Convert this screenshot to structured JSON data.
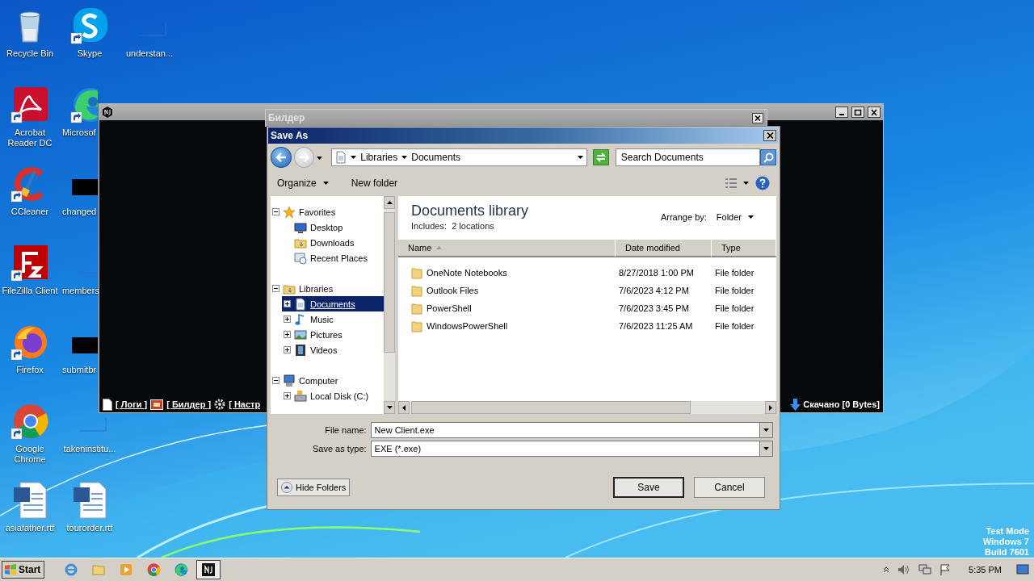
{
  "desktop": {
    "columns": [
      [
        {
          "label": "Recycle Bin",
          "kind": "bin",
          "shortcut": false
        },
        {
          "label": "Acrobat Reader DC",
          "kind": "acrobat",
          "shortcut": true
        },
        {
          "label": "CCleaner",
          "kind": "ccleaner",
          "shortcut": true
        },
        {
          "label": "FileZilla Client",
          "kind": "filezilla",
          "shortcut": true
        },
        {
          "label": "Firefox",
          "kind": "firefox",
          "shortcut": true
        },
        {
          "label": "Google Chrome",
          "kind": "chrome",
          "shortcut": true
        },
        {
          "label": "asiafather.rtf",
          "kind": "word",
          "shortcut": false
        }
      ],
      [
        {
          "label": "Skype",
          "kind": "skype",
          "shortcut": true
        },
        {
          "label": "Microsof",
          "kind": "edge",
          "shortcut": true,
          "cut": true
        },
        {
          "label": "changed",
          "kind": "black",
          "shortcut": false,
          "cut": true
        },
        {
          "label": "members",
          "kind": "blank",
          "shortcut": false,
          "cut": true
        },
        {
          "label": "submitbr",
          "kind": "black",
          "shortcut": false,
          "cut": true
        },
        {
          "label": "takeninstitu...",
          "kind": "blank",
          "shortcut": false
        },
        {
          "label": "tourorder.rtf",
          "kind": "word",
          "shortcut": false
        }
      ],
      [
        {
          "label": "understan...",
          "kind": "blank",
          "shortcut": false
        }
      ]
    ],
    "os_notice": [
      "Test Mode",
      "Windows 7",
      "Build 7601"
    ]
  },
  "console_window": {
    "status_items": [
      {
        "label": "[ Логи ]",
        "kind": "logs"
      },
      {
        "label": "[ Билдер ]",
        "kind": "builder"
      },
      {
        "label": "[ Настр",
        "kind": "settings"
      }
    ],
    "download": "Скачано [0 Bytes]"
  },
  "builder_window": {
    "title": "Билдер"
  },
  "save_dialog": {
    "title": "Save As",
    "breadcrumb": [
      "Libraries",
      "Documents"
    ],
    "search": {
      "placeholder": "Search Documents"
    },
    "toolbar": [
      {
        "label": "Organize",
        "menu": true
      },
      {
        "label": "New folder",
        "menu": false
      }
    ],
    "tree": [
      {
        "label": "Favorites",
        "kind": "star",
        "expanded": true,
        "selected": false,
        "children": [
          {
            "label": "Desktop",
            "kind": "desktop",
            "selected": false
          },
          {
            "label": "Downloads",
            "kind": "downloads",
            "selected": false
          },
          {
            "label": "Recent Places",
            "kind": "recent",
            "selected": false
          }
        ]
      },
      {
        "label": "Libraries",
        "kind": "libraries",
        "expanded": true,
        "selected": false,
        "children": [
          {
            "label": "Documents",
            "kind": "documents",
            "expanded": false,
            "selected": true
          },
          {
            "label": "Music",
            "kind": "music",
            "expanded": false,
            "selected": false
          },
          {
            "label": "Pictures",
            "kind": "pictures",
            "expanded": false,
            "selected": false
          },
          {
            "label": "Videos",
            "kind": "videos",
            "expanded": false,
            "selected": false
          }
        ]
      },
      {
        "label": "Computer",
        "kind": "computer",
        "expanded": true,
        "selected": false,
        "children": [
          {
            "label": "Local Disk (C:)",
            "kind": "disk",
            "expanded": false,
            "selected": false
          }
        ]
      }
    ],
    "library": {
      "title": "Documents library",
      "includes_label": "Includes:",
      "includes_value": "2 locations",
      "arrange_label": "Arrange by:",
      "arrange_value": "Folder"
    },
    "columns": [
      "Name",
      "Date modified",
      "Type"
    ],
    "rows": [
      {
        "name": "OneNote Notebooks",
        "date": "8/27/2018 1:00 PM",
        "type": "File folder"
      },
      {
        "name": "Outlook Files",
        "date": "7/6/2023 4:12 PM",
        "type": "File folder"
      },
      {
        "name": "PowerShell",
        "date": "7/6/2023 3:45 PM",
        "type": "File folder"
      },
      {
        "name": "WindowsPowerShell",
        "date": "7/6/2023 11:25 AM",
        "type": "File folder"
      }
    ],
    "file_name": {
      "label": "File name:",
      "value": "New Client.exe"
    },
    "save_type": {
      "label": "Save as type:",
      "value": "EXE (*.exe)"
    },
    "hide_folders": "Hide Folders",
    "buttons": [
      "Save",
      "Cancel"
    ]
  },
  "taskbar": {
    "start": "Start",
    "apps": [
      {
        "kind": "ie",
        "active": false
      },
      {
        "kind": "explorer",
        "active": false
      },
      {
        "kind": "media",
        "active": false
      },
      {
        "kind": "chrome",
        "active": false
      },
      {
        "kind": "edge",
        "active": false
      },
      {
        "kind": "nj",
        "active": true
      }
    ],
    "clock": "5:35 PM"
  }
}
